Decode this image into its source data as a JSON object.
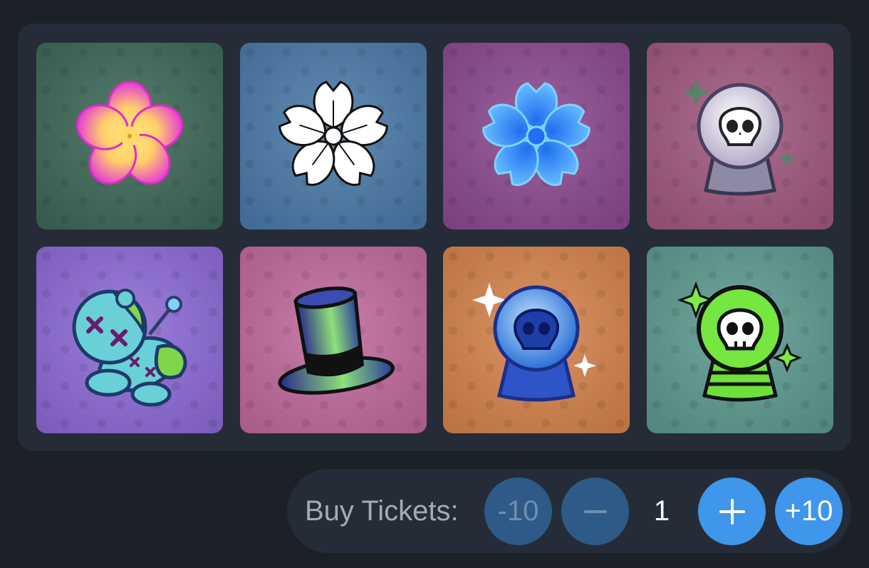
{
  "items": [
    {
      "name": "pink-plumeria-flower",
      "bg": "#3d6858"
    },
    {
      "name": "white-sakura-flower",
      "bg": "#4a7aa8"
    },
    {
      "name": "blue-flower",
      "bg": "#8c4a90"
    },
    {
      "name": "skull-crystal-ball",
      "bg": "#a0587e"
    },
    {
      "name": "voodoo-doll",
      "bg": "#8d6ad6"
    },
    {
      "name": "top-hat",
      "bg": "#c06a9c"
    },
    {
      "name": "blue-skull-crystal-ball",
      "bg": "#d6834d"
    },
    {
      "name": "green-skull-crystal-ball",
      "bg": "#5c9a90"
    }
  ],
  "tickets": {
    "label": "Buy Tickets:",
    "minus_ten": "-10",
    "minus_icon": "minus-icon",
    "quantity": "1",
    "plus_icon": "plus-icon",
    "plus_ten": "+10"
  },
  "colors": {
    "page_bg": "#1c2128",
    "panel_bg": "#252c37",
    "button_active": "#3f96ea",
    "button_disabled": "#2d5a86",
    "label_text": "#a3abb8"
  }
}
